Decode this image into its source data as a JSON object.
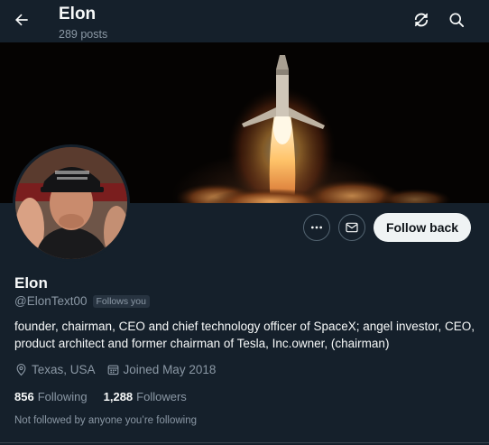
{
  "header": {
    "title": "Elon",
    "post_count": "289 posts",
    "icons": [
      "back-arrow-icon",
      "refresh-icon",
      "search-icon"
    ]
  },
  "actions": {
    "more_icon": "ellipsis-icon",
    "message_icon": "mail-icon",
    "follow_back_label": "Follow back"
  },
  "profile": {
    "name": "Elon",
    "handle": "@ElonText00",
    "follows_you_badge": "Follows you",
    "bio": "founder, chairman, CEO and chief technology officer of SpaceX; angel investor, CEO, product architect and former chairman of Tesla, Inc.owner, (chairman)",
    "location": "Texas, USA",
    "joined": "Joined May 2018",
    "following_count": "856",
    "following_label": "Following",
    "followers_count": "1,288",
    "followers_label": "Followers",
    "not_followed_text": "Not followed by anyone you’re following"
  },
  "colors": {
    "background": "#15202b",
    "text_primary": "#f7f9f9",
    "text_secondary": "#8b98a5",
    "button_light": "#eff3f4",
    "border": "#536471"
  }
}
